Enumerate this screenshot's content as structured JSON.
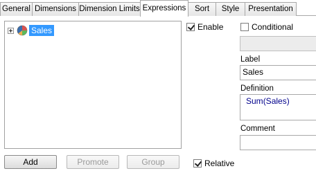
{
  "tabs": [
    {
      "label": "General",
      "active": false
    },
    {
      "label": "Dimensions",
      "active": false
    },
    {
      "label": "Dimension Limits",
      "active": false
    },
    {
      "label": "Expressions",
      "active": true
    },
    {
      "label": "Sort",
      "active": false
    },
    {
      "label": "Style",
      "active": false
    },
    {
      "label": "Presentation",
      "active": false
    }
  ],
  "tree": {
    "items": [
      {
        "label": "Sales",
        "icon": "pie-chart-icon",
        "expanded": false,
        "selected": true
      }
    ]
  },
  "options": {
    "enable_label": "Enable",
    "enable_checked": true,
    "conditional_label": "Conditional",
    "conditional_checked": false,
    "relative_label": "Relative",
    "relative_checked": true
  },
  "expression": {
    "label_caption": "Label",
    "label_value": "Sales",
    "definition_caption": "Definition",
    "definition_func": "Sum",
    "definition_arg": "(Sales)",
    "comment_caption": "Comment",
    "comment_value": ""
  },
  "buttons": {
    "add": "Add",
    "promote": "Promote",
    "group": "Group"
  },
  "colors": {
    "selection": "#3399ff",
    "definition_text": "#00008b",
    "pie_slices": [
      "#3a6fb0",
      "#d9534f",
      "#5cb85c",
      "#f0ad4e"
    ]
  }
}
